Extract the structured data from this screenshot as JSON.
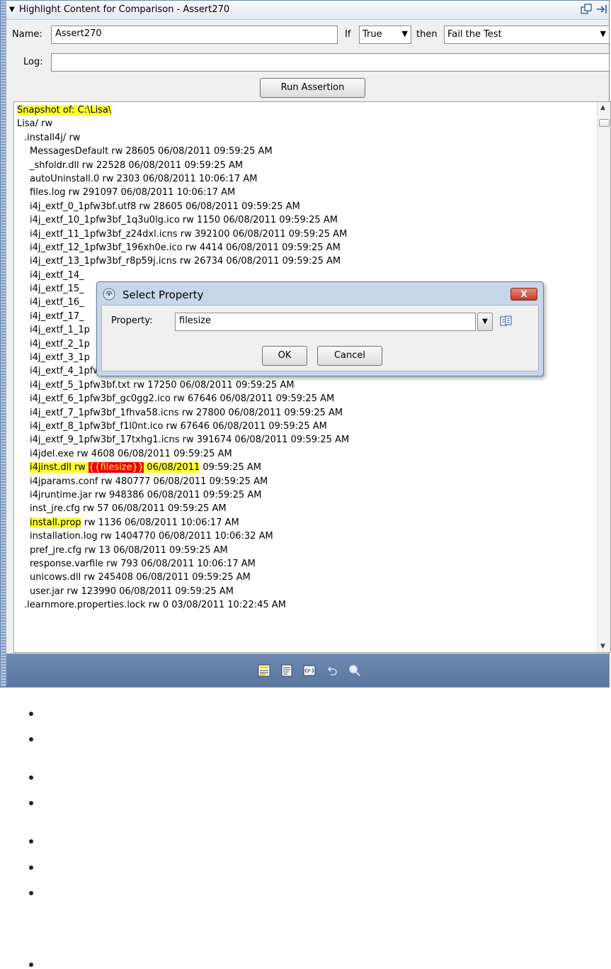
{
  "window": {
    "title": "Highlight Content for Comparison - Assert270"
  },
  "form": {
    "name_label": "Name:",
    "name_value": "Assert270",
    "if_label": "If",
    "if_value": "True",
    "then_label": "then",
    "then_value": "Fail the Test",
    "log_label": "Log:",
    "log_value": "",
    "run_button": "Run Assertion"
  },
  "content": {
    "lines": [
      {
        "indent": 0,
        "parts": [
          {
            "t": "Snapshot of: C:\\Lisa\\",
            "hl": "y"
          }
        ]
      },
      {
        "indent": 0,
        "parts": [
          {
            "t": "Lisa/ rw"
          }
        ]
      },
      {
        "indent": 1,
        "parts": [
          {
            "t": ".install4j/ rw"
          }
        ]
      },
      {
        "indent": 2,
        "parts": [
          {
            "t": "MessagesDefault rw 28605 06/08/2011 09:59:25 AM"
          }
        ]
      },
      {
        "indent": 2,
        "parts": [
          {
            "t": "_shfoldr.dll rw 22528 06/08/2011 09:59:25 AM"
          }
        ]
      },
      {
        "indent": 2,
        "parts": [
          {
            "t": "autoUninstall.0 rw 2303 06/08/2011 10:06:17 AM"
          }
        ]
      },
      {
        "indent": 2,
        "parts": [
          {
            "t": "files.log rw 291097 06/08/2011 10:06:17 AM"
          }
        ]
      },
      {
        "indent": 2,
        "parts": [
          {
            "t": "i4j_extf_0_1pfw3bf.utf8 rw 28605 06/08/2011 09:59:25 AM"
          }
        ]
      },
      {
        "indent": 2,
        "parts": [
          {
            "t": "i4j_extf_10_1pfw3bf_1q3u0lg.ico rw 1150 06/08/2011 09:59:25 AM"
          }
        ]
      },
      {
        "indent": 2,
        "parts": [
          {
            "t": "i4j_extf_11_1pfw3bf_z24dxl.icns rw 392100 06/08/2011 09:59:25 AM"
          }
        ]
      },
      {
        "indent": 2,
        "parts": [
          {
            "t": "i4j_extf_12_1pfw3bf_196xh0e.ico rw 4414 06/08/2011 09:59:25 AM"
          }
        ]
      },
      {
        "indent": 2,
        "parts": [
          {
            "t": "i4j_extf_13_1pfw3bf_r8p59j.icns rw 26734 06/08/2011 09:59:25 AM"
          }
        ]
      },
      {
        "indent": 2,
        "parts": [
          {
            "t": "i4j_extf_14_"
          }
        ]
      },
      {
        "indent": 2,
        "parts": [
          {
            "t": "i4j_extf_15_"
          }
        ]
      },
      {
        "indent": 2,
        "parts": [
          {
            "t": "i4j_extf_16_"
          }
        ]
      },
      {
        "indent": 2,
        "parts": [
          {
            "t": "i4j_extf_17_"
          }
        ]
      },
      {
        "indent": 2,
        "parts": [
          {
            "t": "i4j_extf_1_1p"
          }
        ]
      },
      {
        "indent": 2,
        "parts": [
          {
            "t": "i4j_extf_2_1p"
          }
        ]
      },
      {
        "indent": 2,
        "parts": [
          {
            "t": "i4j_extf_3_1p"
          }
        ]
      },
      {
        "indent": 2,
        "parts": [
          {
            "t": "i4j_extf_4_1pfw3bf_6nmoby.png rw 73436 06/08/2011 09:59:25 AM"
          }
        ]
      },
      {
        "indent": 2,
        "parts": [
          {
            "t": "i4j_extf_5_1pfw3bf.txt rw 17250 06/08/2011 09:59:25 AM"
          }
        ]
      },
      {
        "indent": 2,
        "parts": [
          {
            "t": "i4j_extf_6_1pfw3bf_gc0gg2.ico rw 67646 06/08/2011 09:59:25 AM"
          }
        ]
      },
      {
        "indent": 2,
        "parts": [
          {
            "t": "i4j_extf_7_1pfw3bf_1fhva58.icns rw 27800 06/08/2011 09:59:25 AM"
          }
        ]
      },
      {
        "indent": 2,
        "parts": [
          {
            "t": "i4j_extf_8_1pfw3bf_f1l0nt.ico rw 67646 06/08/2011 09:59:25 AM"
          }
        ]
      },
      {
        "indent": 2,
        "parts": [
          {
            "t": "i4j_extf_9_1pfw3bf_17txhg1.icns rw 391674 06/08/2011 09:59:25 AM"
          }
        ]
      },
      {
        "indent": 2,
        "parts": [
          {
            "t": "i4jdel.exe rw 4608 06/08/2011 09:59:25 AM"
          }
        ]
      },
      {
        "indent": 2,
        "parts": [
          {
            "t": "i4jinst.dll rw ",
            "hl": "y"
          },
          {
            "t": "{{filesize}}",
            "hl": "r"
          },
          {
            "t": " 06/08/2011",
            "hl": "y"
          },
          {
            "t": " 09:59:25 AM"
          }
        ]
      },
      {
        "indent": 2,
        "parts": [
          {
            "t": "i4jparams.conf rw 480777 06/08/2011 09:59:25 AM"
          }
        ]
      },
      {
        "indent": 2,
        "parts": [
          {
            "t": "i4jruntime.jar rw 948386 06/08/2011 09:59:25 AM"
          }
        ]
      },
      {
        "indent": 2,
        "parts": [
          {
            "t": "inst_jre.cfg rw 57 06/08/2011 09:59:25 AM"
          }
        ]
      },
      {
        "indent": 2,
        "parts": [
          {
            "t": "install.prop",
            "hl": "y"
          },
          {
            "t": " rw 1136 06/08/2011 10:06:17 AM"
          }
        ]
      },
      {
        "indent": 2,
        "parts": [
          {
            "t": "installation.log rw 1404770 06/08/2011 10:06:32 AM"
          }
        ]
      },
      {
        "indent": 2,
        "parts": [
          {
            "t": "pref_jre.cfg rw 13 06/08/2011 09:59:25 AM"
          }
        ]
      },
      {
        "indent": 2,
        "parts": [
          {
            "t": "response.varfile rw 793 06/08/2011 10:06:17 AM"
          }
        ]
      },
      {
        "indent": 2,
        "parts": [
          {
            "t": "unicows.dll rw 245408 06/08/2011 09:59:25 AM"
          }
        ]
      },
      {
        "indent": 2,
        "parts": [
          {
            "t": "user.jar rw 123990 06/08/2011 09:59:25 AM"
          }
        ]
      },
      {
        "indent": 1,
        "parts": [
          {
            "t": ".learnmore.properties.lock rw 0 03/08/2011 10:22:45 AM"
          }
        ]
      }
    ]
  },
  "dialog": {
    "title": "Select Property",
    "close_label": "X",
    "property_label": "Property:",
    "property_value": "filesize",
    "ok": "OK",
    "cancel": "Cancel"
  },
  "icons": {
    "title": [
      "float-window-icon",
      "pin-window-icon"
    ],
    "bottom": [
      "highlight-icon",
      "text-view-icon",
      "property-icon",
      "undo-icon",
      "search-icon"
    ]
  },
  "colors": {
    "highlight_yellow": "#ffff33",
    "highlight_red": "#e60000",
    "bottom_bar": "#5f7ba4"
  }
}
